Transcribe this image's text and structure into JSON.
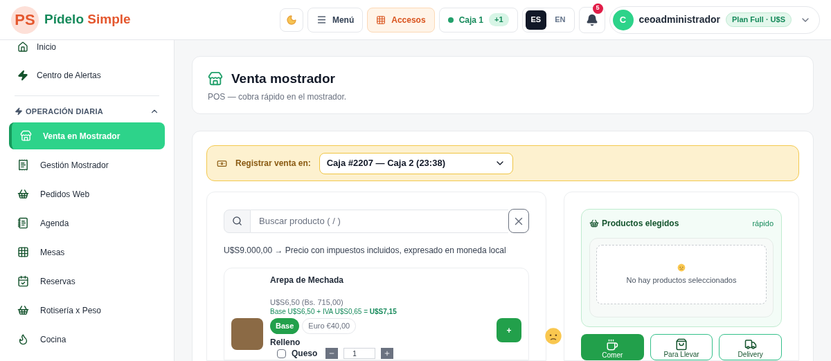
{
  "brand": {
    "logo": "PS",
    "name_part_1": "Pídelo",
    "name_part_2": "Simple"
  },
  "topbar": {
    "menu": "Menú",
    "accesos": "Accesos",
    "caja": "Caja 1",
    "caja_badge": "+1",
    "languages": [
      {
        "label": "ES",
        "selected": true
      },
      {
        "label": "EN",
        "selected": false
      }
    ],
    "notifications": "5",
    "user": {
      "initial": "C",
      "name": "ceoadministrador",
      "plan": "Plan Full · U$S"
    }
  },
  "sidebar": {
    "items_top": [
      {
        "label": "Inicio",
        "selected": false
      },
      {
        "label": "Centro de Alertas",
        "selected": false
      }
    ],
    "section": {
      "label": "OPERACIÓN DIARIA",
      "expanded": true,
      "items": [
        {
          "label": "Venta en Mostrador",
          "selected": true
        },
        {
          "label": "Gestión Mostrador",
          "selected": false
        },
        {
          "label": "Pedidos Web",
          "selected": false
        },
        {
          "label": "Agenda",
          "selected": false
        },
        {
          "label": "Mesas",
          "selected": false
        },
        {
          "label": "Reservas",
          "selected": false
        },
        {
          "label": "Rotisería x Peso",
          "selected": false
        },
        {
          "label": "Cocina",
          "selected": false
        }
      ]
    }
  },
  "page": {
    "title": "Venta mostrador",
    "subtitle": "POS — cobra rápido en el mostrador."
  },
  "register": {
    "label": "Registrar venta en:",
    "value": "Caja #2207 — Caja 2 (23:38)"
  },
  "search": {
    "placeholder": "Buscar producto ( / )"
  },
  "price_note": "U$S9.000,00 → Precio con impuestos incluidos, expresado en moneda local",
  "product": {
    "name": "Arepa de Mechada",
    "price": "U$S6,50 (Bs. 715,00)",
    "breakdown": "Base U$S6,50 + IVA U$S0,65 = **U$S7,15**",
    "price_options": [
      {
        "label": "Base",
        "selected": true
      },
      {
        "label": "Euro €40,00",
        "selected": false
      }
    ],
    "add": "+",
    "group": "Relleno",
    "options": [
      {
        "label": "Queso",
        "checked": false,
        "quantity": "1"
      }
    ]
  },
  "cart": {
    "title": "Productos elegidos",
    "mode": "rápido",
    "empty": "No hay productos seleccionados"
  },
  "order_types": [
    {
      "label": "Comer",
      "selected": true
    },
    {
      "label": "Para Llevar",
      "selected": false
    },
    {
      "label": "Delivery",
      "selected": false
    }
  ]
}
